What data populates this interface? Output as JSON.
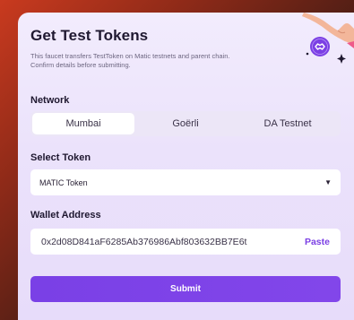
{
  "header": {
    "title": "Get Test Tokens",
    "subtitle": "This faucet transfers TestToken on Matic testnets and parent chain. Confirm details before submitting."
  },
  "network": {
    "label": "Network",
    "tabs": [
      {
        "label": "Mumbai",
        "selected": true
      },
      {
        "label": "Goërli",
        "selected": false
      },
      {
        "label": "DA Testnet",
        "selected": false
      }
    ]
  },
  "token": {
    "label": "Select Token",
    "selected": "MATIC Token"
  },
  "wallet": {
    "label": "Wallet Address",
    "value": "0x2d08D841aF6285Ab376986Abf803632BB7E6t",
    "paste_label": "Paste"
  },
  "submit_label": "Submit",
  "colors": {
    "accent": "#7b3fe4",
    "card_bg": "#efe8fc",
    "title": "#1f1830"
  }
}
